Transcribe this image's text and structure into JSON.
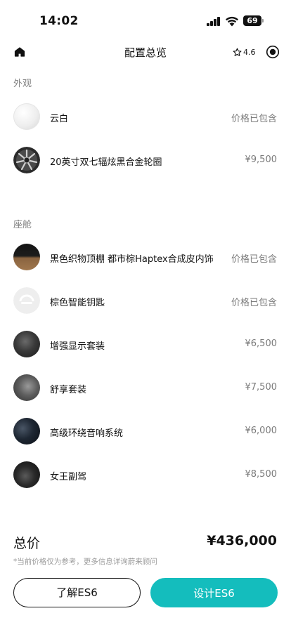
{
  "status_bar": {
    "time": "14:02",
    "battery": "69"
  },
  "nav": {
    "title": "配置总览",
    "rating": "4.6"
  },
  "exterior": {
    "label": "外观",
    "items": [
      {
        "name": "云白",
        "price": "价格已包含"
      },
      {
        "name": "20英寸双七辐炫黑合金轮圈",
        "price": "¥9,500"
      }
    ]
  },
  "cabin": {
    "label": "座舱",
    "items": [
      {
        "name": "黑色织物顶棚 都市棕Haptex合成皮内饰",
        "price": "价格已包含"
      },
      {
        "name": "棕色智能钥匙",
        "price": "价格已包含"
      },
      {
        "name": "增强显示套装",
        "price": "¥6,500"
      },
      {
        "name": "舒享套装",
        "price": "¥7,500"
      },
      {
        "name": "高级环绕音响系统",
        "price": "¥6,000"
      },
      {
        "name": "女王副驾",
        "price": "¥8,500"
      }
    ]
  },
  "summary": {
    "total_label": "总价",
    "total_value": "¥436,000",
    "disclaimer": "*当前价格仅为参考，更多信息详询蔚来顾问"
  },
  "actions": {
    "learn_label": "了解ES6",
    "design_label": "设计ES6"
  },
  "colors": {
    "accent": "#14bdbd",
    "text": "#111111",
    "muted": "#808080"
  }
}
